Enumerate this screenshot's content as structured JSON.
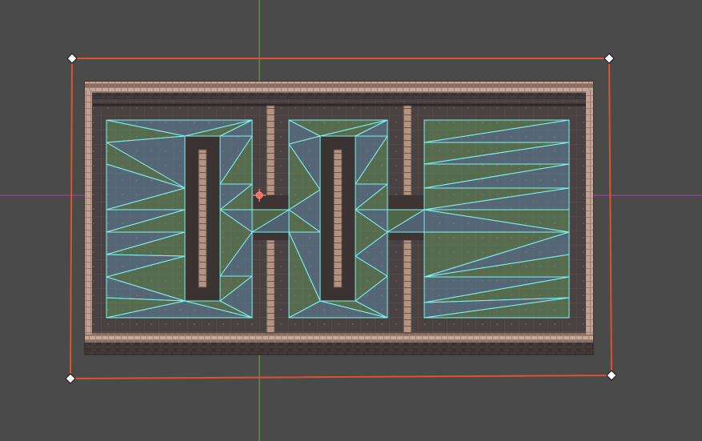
{
  "colors": {
    "background": "#4a4a4a",
    "wall_outer": "#3b3232",
    "wall_brick": "#9a7e71",
    "wall_brick_light": "#c5a89a",
    "floor": "#4a4242",
    "floor_grid": "#5c5252",
    "pillar": "#b39384",
    "pillar_dark": "#5a4a44",
    "navmesh_fill_a": "#5f86a0",
    "navmesh_fill_b": "#62905a",
    "navmesh_edge": "#7df0f0",
    "selection_rect": "#e0522a",
    "axis_x": "#b040b0",
    "axis_y": "#6ab02c",
    "pivot": "#ff7060",
    "handle_fill": "#ffffff",
    "handle_stroke": "#222222"
  },
  "icons": {
    "pivot": "crosshair-pivot-icon",
    "handle": "diamond-handle-icon"
  }
}
